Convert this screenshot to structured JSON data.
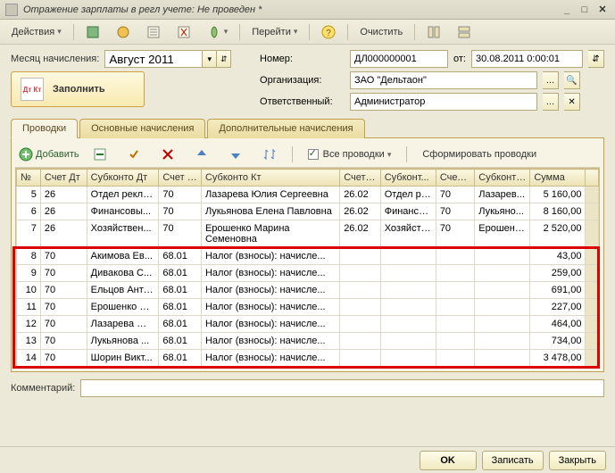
{
  "window": {
    "title": "Отражение зарплаты в регл учете: Не проведен *"
  },
  "toolbar": {
    "actions": "Действия",
    "go": "Перейти",
    "clear": "Очистить"
  },
  "header": {
    "month_label": "Месяц начисления:",
    "month_value": "Август 2011",
    "number_label": "Номер:",
    "number_value": "ДЛ000000001",
    "from_label": "от:",
    "date_value": "30.08.2011 0:00:01",
    "org_label": "Организация:",
    "org_value": "ЗАО \"Дельтаон\"",
    "resp_label": "Ответственный:",
    "resp_value": "Администратор",
    "fill_btn": "Заполнить",
    "fill_icon_text": "Дт Кт"
  },
  "tabs": {
    "t1": "Проводки",
    "t2": "Основные начисления",
    "t3": "Дополнительные начисления"
  },
  "gridbar": {
    "add": "Добавить",
    "all": "Все проводки",
    "form": "Сформировать проводки"
  },
  "columns": {
    "c0": "№",
    "c1": "Счет Дт",
    "c2": "Субконто Дт",
    "c3": "Счет Кт",
    "c4": "Субконто Кт",
    "c5": "Счет ...",
    "c6": "Субконт...",
    "c7": "Счет ...",
    "c8": "Субконто...",
    "c9": "Сумма"
  },
  "rows": [
    {
      "n": "5",
      "dt": "26",
      "sdt": "Отдел рекла...",
      "kt": "70",
      "skt": "Лазарева Юлия Сергеевна",
      "a5": "26.02",
      "a6": "Отдел ре...",
      "a7": "70",
      "a8": "Лазарев...",
      "sum": "5 160,00"
    },
    {
      "n": "6",
      "dt": "26",
      "sdt": "Финансовы...",
      "kt": "70",
      "skt": "Лукьянова Елена Павловна",
      "a5": "26.02",
      "a6": "Финансо...",
      "a7": "70",
      "a8": "Лукьяно...",
      "sum": "8 160,00"
    },
    {
      "n": "7",
      "dt": "26",
      "sdt": "Хозяйствен...",
      "kt": "70",
      "skt": "Ерошенко Марина Семеновна",
      "a5": "26.02",
      "a6": "Хозяйств...",
      "a7": "70",
      "a8": "Ерошенк...",
      "sum": "2 520,00"
    },
    {
      "n": "8",
      "dt": "70",
      "sdt": "Акимова Ев...",
      "kt": "68.01",
      "skt": "Налог (взносы): начисле...",
      "a5": "",
      "a6": "",
      "a7": "",
      "a8": "",
      "sum": "43,00"
    },
    {
      "n": "9",
      "dt": "70",
      "sdt": "Дивакова С...",
      "kt": "68.01",
      "skt": "Налог (взносы): начисле...",
      "a5": "",
      "a6": "",
      "a7": "",
      "a8": "",
      "sum": "259,00"
    },
    {
      "n": "10",
      "dt": "70",
      "sdt": "Ельцов Анто...",
      "kt": "68.01",
      "skt": "Налог (взносы): начисле...",
      "a5": "",
      "a6": "",
      "a7": "",
      "a8": "",
      "sum": "691,00"
    },
    {
      "n": "11",
      "dt": "70",
      "sdt": "Ерошенко М...",
      "kt": "68.01",
      "skt": "Налог (взносы): начисле...",
      "a5": "",
      "a6": "",
      "a7": "",
      "a8": "",
      "sum": "227,00"
    },
    {
      "n": "12",
      "dt": "70",
      "sdt": "Лазарева Ю...",
      "kt": "68.01",
      "skt": "Налог (взносы): начисле...",
      "a5": "",
      "a6": "",
      "a7": "",
      "a8": "",
      "sum": "464,00"
    },
    {
      "n": "13",
      "dt": "70",
      "sdt": "Лукьянова ...",
      "kt": "68.01",
      "skt": "Налог (взносы): начисле...",
      "a5": "",
      "a6": "",
      "a7": "",
      "a8": "",
      "sum": "734,00"
    },
    {
      "n": "14",
      "dt": "70",
      "sdt": "Шорин Викт...",
      "kt": "68.01",
      "skt": "Налог (взносы): начисле...",
      "a5": "",
      "a6": "",
      "a7": "",
      "a8": "",
      "sum": "3 478,00"
    }
  ],
  "comment": {
    "label": "Комментарий:",
    "value": ""
  },
  "footer": {
    "ok": "OK",
    "save": "Записать",
    "close": "Закрыть"
  }
}
